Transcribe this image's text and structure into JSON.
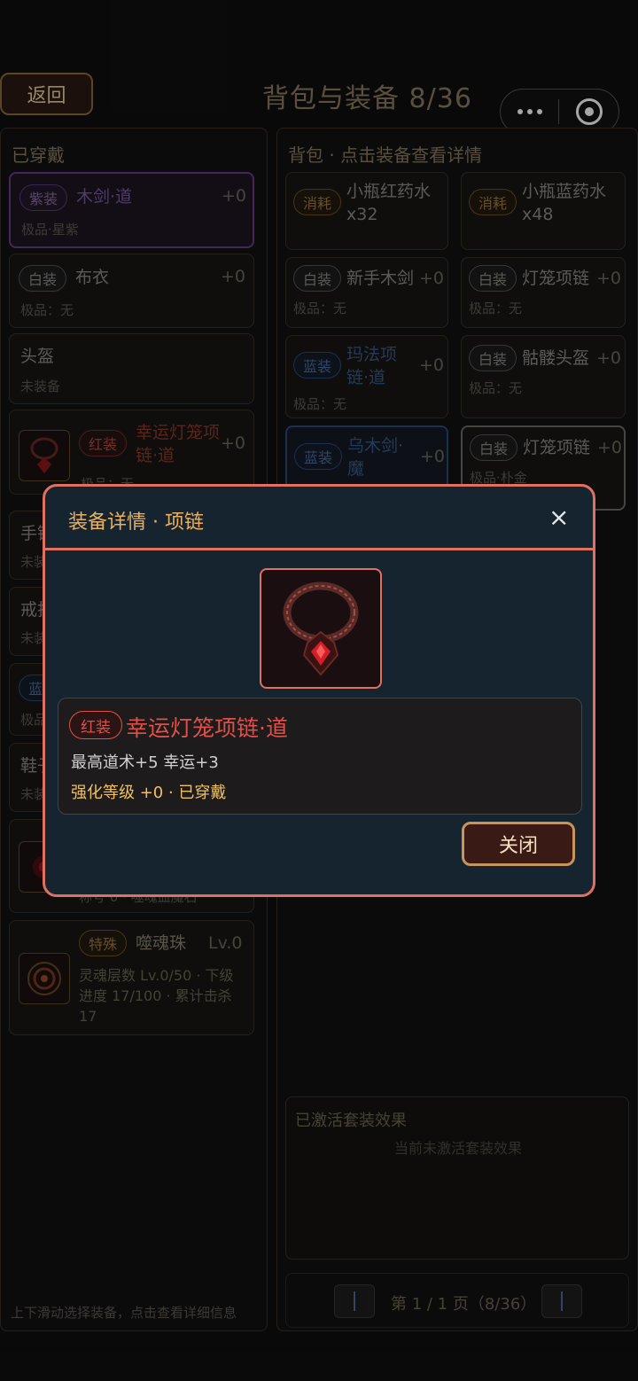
{
  "header": {
    "back_label": "返回",
    "title": "背包与装备 8/36"
  },
  "equipped": {
    "title": "已穿戴",
    "slots": [
      {
        "tag": "紫装",
        "name": "木剑·道",
        "plus": "+0",
        "sub": "极品·星紫"
      },
      {
        "tag": "白装",
        "name": "布衣",
        "plus": "+0",
        "sub": "极品：无"
      },
      {
        "name": "头盔",
        "sub": "未装备"
      },
      {
        "tag": "红装",
        "name": "幸运灯笼项链·道",
        "plus": "+0",
        "sub": "极品：无"
      },
      {
        "name": "手镯",
        "sub": "未装备"
      },
      {
        "name": "戒指",
        "sub": "未装备"
      },
      {
        "tag": "蓝装",
        "sub": "极品"
      },
      {
        "name": "鞋子",
        "sub": "未装备"
      },
      {
        "sub": "称号 0 · 噬魂血魔石"
      },
      {
        "tag": "特殊",
        "name": "噬魂珠",
        "plus": "Lv.0",
        "sub": "灵魂层数 Lv.0/50 · 下级进度 17/100 · 累计击杀 17"
      }
    ],
    "hint": "上下滑动选择装备，点击查看详细信息"
  },
  "bag": {
    "title": "背包 · 点击装备查看详情",
    "items": [
      {
        "tag": "消耗",
        "name": "小瓶红药水",
        "count": "x32"
      },
      {
        "tag": "消耗",
        "name": "小瓶蓝药水",
        "count": "x48"
      },
      {
        "tag": "白装",
        "name": "新手木剑",
        "plus": "+0",
        "sub": "极品：无"
      },
      {
        "tag": "白装",
        "name": "灯笼项链",
        "plus": "+0",
        "sub": "极品：无"
      },
      {
        "tag": "蓝装",
        "name": "玛法项链·道",
        "plus": "+0",
        "sub": "极品：无"
      },
      {
        "tag": "白装",
        "name": "骷髅头盔",
        "plus": "+0",
        "sub": "极品：无"
      },
      {
        "tag": "蓝装",
        "name": "乌木剑·魔",
        "plus": "+0"
      },
      {
        "tag": "白装",
        "name": "灯笼项链",
        "plus": "+0",
        "sub": "极品·朴金"
      }
    ],
    "set_effects": {
      "title": "已激活套装效果",
      "empty": "当前未激活套装效果"
    },
    "pager": "第 1 / 1 页（8/36）"
  },
  "modal": {
    "title": "装备详情 · 项链",
    "close_icon": "×",
    "tag": "红装",
    "name": "幸运灯笼项链·道",
    "stats": "最高道术+5 幸运+3",
    "level": "强化等级 +0 · 已穿戴",
    "close_label": "关闭"
  }
}
